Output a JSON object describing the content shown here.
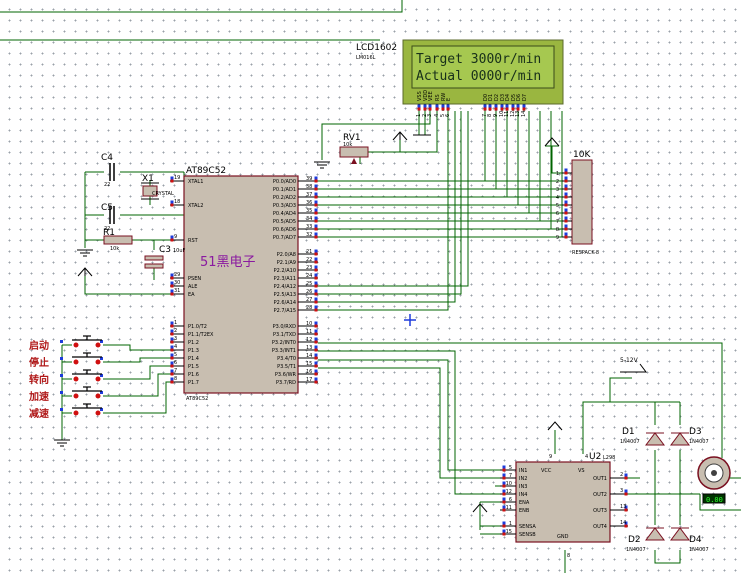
{
  "lcd": {
    "ref": "LCD1602",
    "model": "LM016L",
    "line1": "Target 3000r/min",
    "line2": "Actual 0000r/min",
    "pins": [
      "VSS",
      "VDD",
      "VEE",
      "RS",
      "RW",
      "E",
      "D0",
      "D1",
      "D2",
      "D3",
      "D4",
      "D5",
      "D6",
      "D7"
    ],
    "pin_numbers": [
      "1",
      "2",
      "3",
      "4",
      "5",
      "6",
      "7",
      "8",
      "9",
      "10",
      "11",
      "12",
      "13",
      "14"
    ]
  },
  "mcu": {
    "ref": "AT89C52",
    "ref_bottom": "AT89C52",
    "left_pins": [
      {
        "num": "19",
        "name": "XTAL1"
      },
      {
        "num": "18",
        "name": "XTAL2"
      },
      {
        "num": "9",
        "name": "RST"
      },
      {
        "num": "29",
        "name": "PSEN"
      },
      {
        "num": "30",
        "name": "ALE"
      },
      {
        "num": "31",
        "name": "EA"
      },
      {
        "num": "1",
        "name": "P1.0/T2"
      },
      {
        "num": "2",
        "name": "P1.1/T2EX"
      },
      {
        "num": "3",
        "name": "P1.2"
      },
      {
        "num": "4",
        "name": "P1.3"
      },
      {
        "num": "5",
        "name": "P1.4"
      },
      {
        "num": "6",
        "name": "P1.5"
      },
      {
        "num": "7",
        "name": "P1.6"
      },
      {
        "num": "8",
        "name": "P1.7"
      }
    ],
    "right_pins": [
      {
        "num": "39",
        "name": "P0.0/AD0"
      },
      {
        "num": "38",
        "name": "P0.1/AD1"
      },
      {
        "num": "37",
        "name": "P0.2/AD2"
      },
      {
        "num": "36",
        "name": "P0.3/AD3"
      },
      {
        "num": "35",
        "name": "P0.4/AD4"
      },
      {
        "num": "34",
        "name": "P0.5/AD5"
      },
      {
        "num": "33",
        "name": "P0.6/AD6"
      },
      {
        "num": "32",
        "name": "P0.7/AD7"
      },
      {
        "num": "21",
        "name": "P2.0/A8"
      },
      {
        "num": "22",
        "name": "P2.1/A9"
      },
      {
        "num": "23",
        "name": "P2.2/A10"
      },
      {
        "num": "24",
        "name": "P2.3/A11"
      },
      {
        "num": "25",
        "name": "P2.4/A12"
      },
      {
        "num": "26",
        "name": "P2.5/A13"
      },
      {
        "num": "27",
        "name": "P2.6/A14"
      },
      {
        "num": "28",
        "name": "P2.7/A15"
      },
      {
        "num": "10",
        "name": "P3.0/RXD"
      },
      {
        "num": "11",
        "name": "P3.1/TXD"
      },
      {
        "num": "12",
        "name": "P3.2/INT0"
      },
      {
        "num": "13",
        "name": "P3.3/INT1"
      },
      {
        "num": "14",
        "name": "P3.4/T0"
      },
      {
        "num": "15",
        "name": "P3.5/T1"
      },
      {
        "num": "16",
        "name": "P3.6/WR"
      },
      {
        "num": "17",
        "name": "P3.7/RD"
      }
    ]
  },
  "watermark": "51黑电子",
  "components": {
    "c4": "C4",
    "c4_value": "22",
    "c5": "C5",
    "c5_value": "22",
    "x1": "X1",
    "x1_type": "CRYSTAL",
    "r1": "R1",
    "r1_value": "10k",
    "c3": "C3",
    "c3_value": "10uF",
    "rv1": "RV1",
    "rv1_value": "10k",
    "respack": "10K",
    "respack_type": "RESPACK-8",
    "respack_pins": [
      "1",
      "2",
      "3",
      "4",
      "5",
      "6",
      "7",
      "8",
      "9"
    ]
  },
  "buttons": [
    "启动",
    "停止",
    "转向",
    "加速",
    "减速"
  ],
  "driver": {
    "ref": "U2",
    "type": "L298",
    "left_pins": [
      {
        "num": "5",
        "name": "IN1"
      },
      {
        "num": "7",
        "name": "IN2"
      },
      {
        "num": "10",
        "name": "IN3"
      },
      {
        "num": "12",
        "name": "IN4"
      },
      {
        "num": "6",
        "name": "ENA"
      },
      {
        "num": "11",
        "name": "ENB"
      },
      {
        "num": "1",
        "name": "SENSA"
      },
      {
        "num": "15",
        "name": "SENSB"
      }
    ],
    "right_pins": [
      {
        "num": "2",
        "name": "OUT1"
      },
      {
        "num": "3",
        "name": "OUT2"
      },
      {
        "num": "13",
        "name": "OUT3"
      },
      {
        "num": "14",
        "name": "OUT4"
      }
    ],
    "top_pins": [
      {
        "num": "9",
        "name": "VCC"
      },
      {
        "num": "4",
        "name": "VS"
      }
    ],
    "bottom_pin": {
      "num": "8",
      "name": "GND"
    }
  },
  "diodes": [
    {
      "ref": "D1",
      "type": "1N4007"
    },
    {
      "ref": "D2",
      "type": "1N4007"
    },
    {
      "ref": "D3",
      "type": "1N4007"
    },
    {
      "ref": "D4",
      "type": "1N4007"
    }
  ],
  "supply": "5-12V",
  "motor_readout": "0.00",
  "colors": {
    "wire": "#006400",
    "body": "#c8beb0",
    "outline": "#7a1020",
    "lcd_bg": "#a6c850",
    "lcd_frame": "#9ab640",
    "pin_dot": "#1e3cdc",
    "pin_end": "#d01010",
    "watermark": "#8a1aa0"
  }
}
